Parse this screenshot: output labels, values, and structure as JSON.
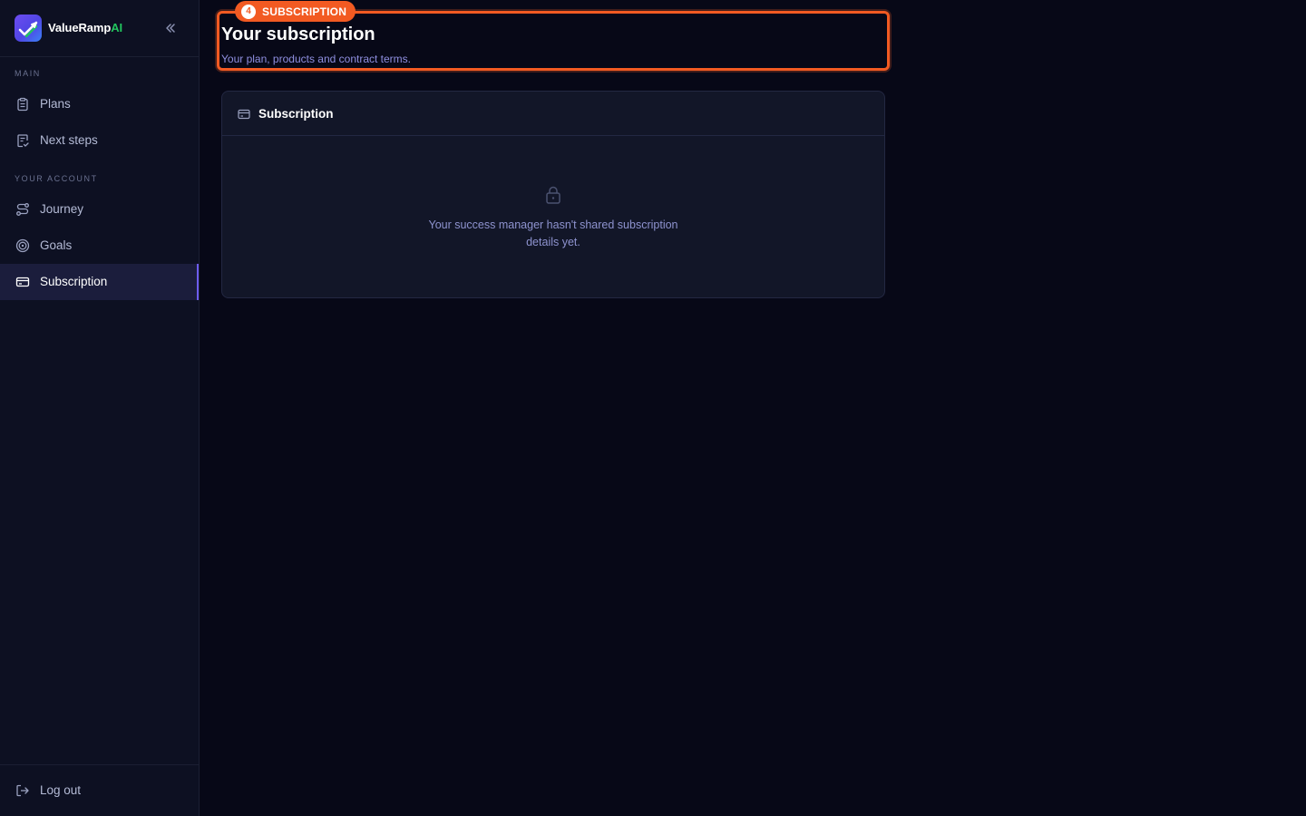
{
  "brand": {
    "name": "ValueRamp",
    "name_suffix": "AI",
    "logo_icon": "check-chart-logo-icon",
    "accent_color": "#22c55e"
  },
  "sidebar": {
    "collapse_icon": "chevrons-left-icon",
    "sections": [
      {
        "label": "MAIN",
        "items": [
          {
            "label": "Plans",
            "icon": "clipboard-list-icon",
            "active": false
          },
          {
            "label": "Next steps",
            "icon": "clipboard-check-icon",
            "active": false
          }
        ]
      },
      {
        "label": "YOUR ACCOUNT",
        "items": [
          {
            "label": "Journey",
            "icon": "route-icon",
            "active": false
          },
          {
            "label": "Goals",
            "icon": "target-icon",
            "active": false
          },
          {
            "label": "Subscription",
            "icon": "credit-card-icon",
            "active": true
          }
        ]
      }
    ],
    "footer": {
      "logout_label": "Log out",
      "logout_icon": "log-out-icon"
    }
  },
  "tour": {
    "step_number": "4",
    "step_label": "SUBSCRIPTION",
    "highlight_color": "#f25a22"
  },
  "main": {
    "title": "Your subscription",
    "subtitle": "Your plan, products and contract terms.",
    "card": {
      "title": "Subscription",
      "icon": "credit-card-icon",
      "empty_icon": "lock-icon",
      "empty_message": "Your success manager hasn't shared subscription details yet."
    }
  }
}
